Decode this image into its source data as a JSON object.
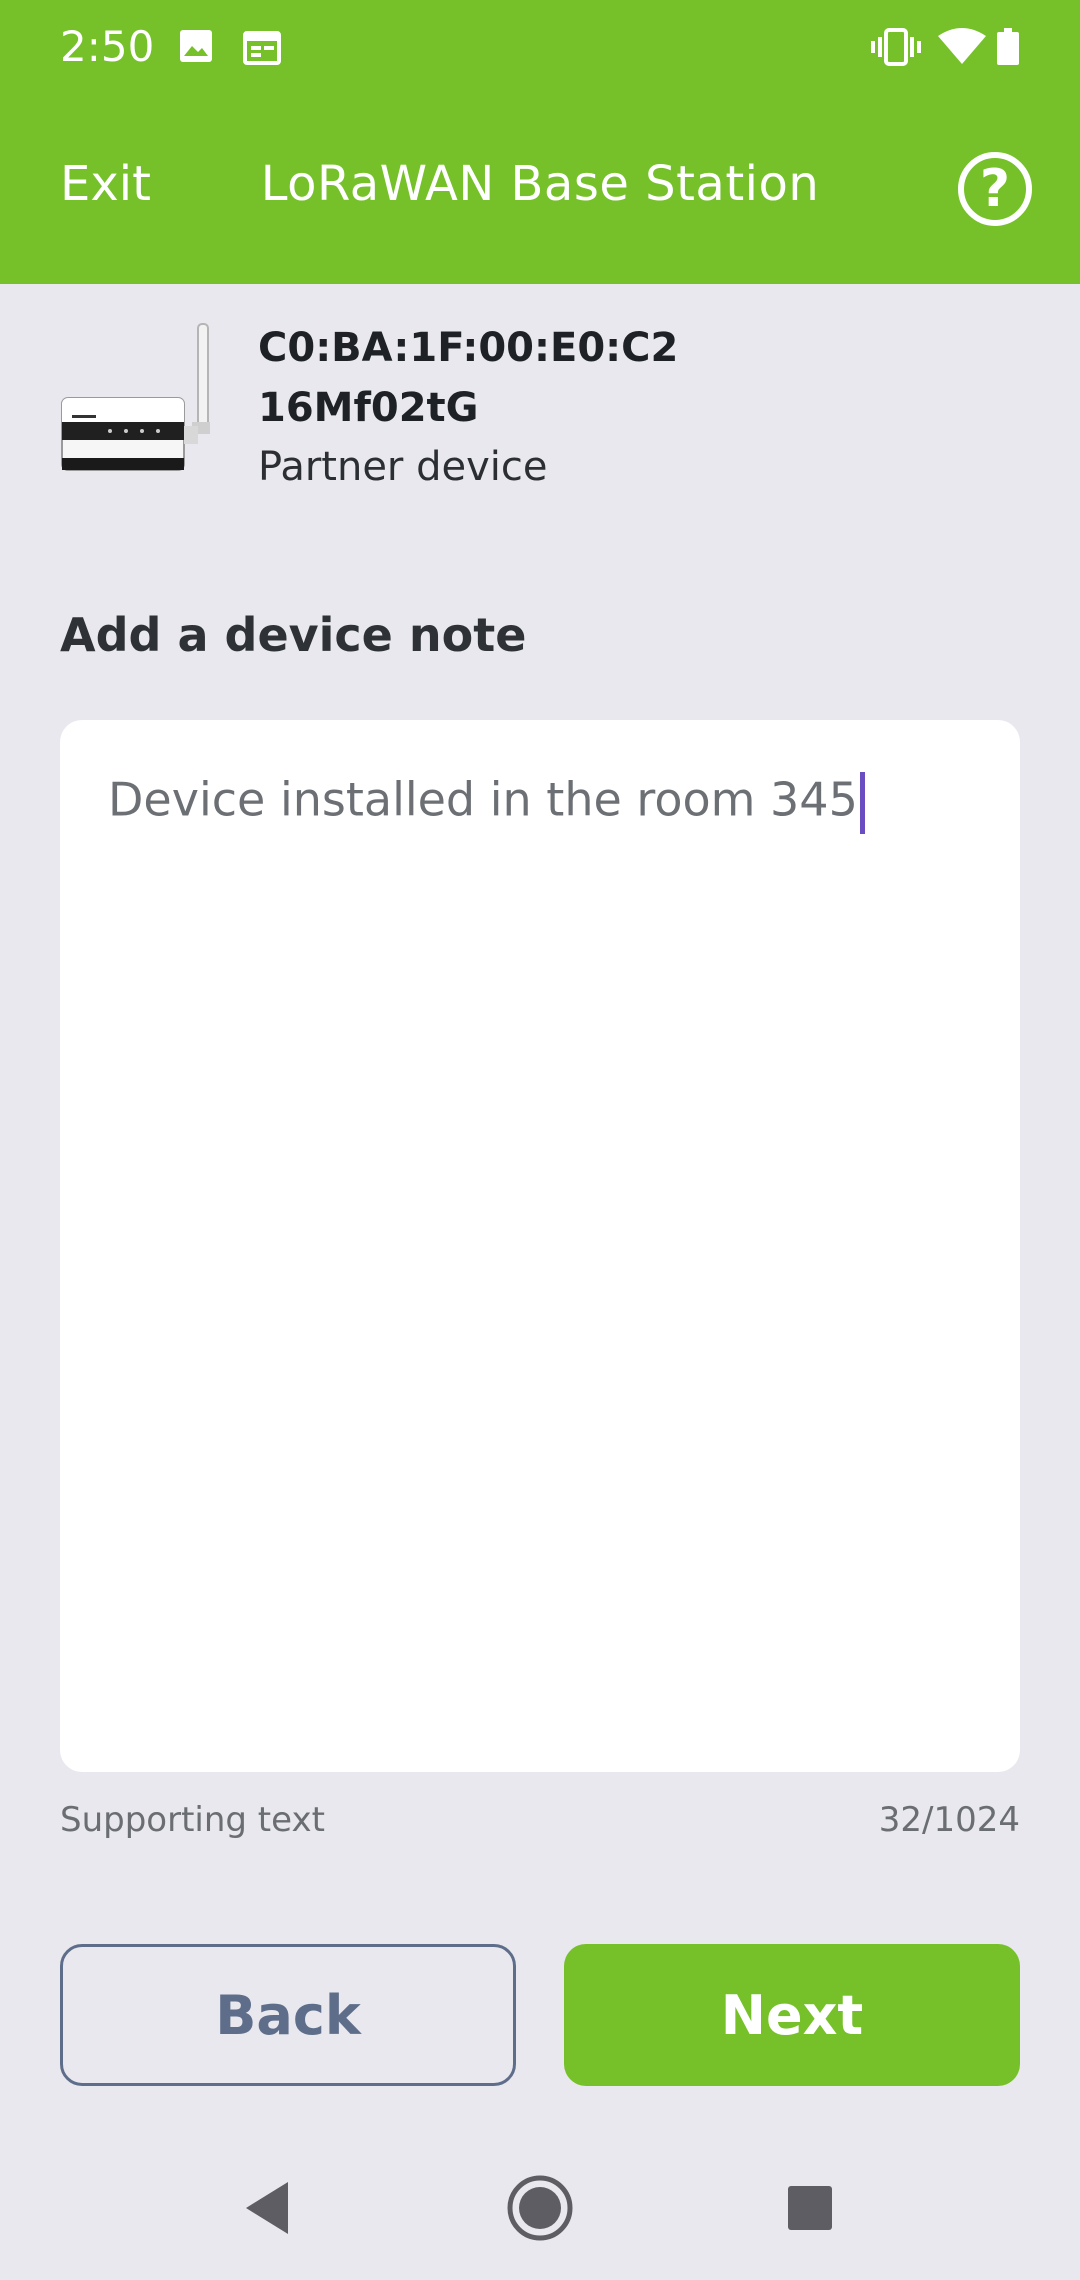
{
  "status_bar": {
    "time": "2:50",
    "left_icons": [
      "image-icon",
      "calendar-icon"
    ],
    "right_icons": [
      "vibrate-icon",
      "wifi-icon",
      "battery-icon"
    ]
  },
  "app_bar": {
    "exit_label": "Exit",
    "title": "LoRaWAN Base Station",
    "help_glyph": "?"
  },
  "device": {
    "mac": "C0:BA:1F:00:E0:C2",
    "code": "16Mf02tG",
    "type": "Partner device",
    "image_icon": "base-station-device-image"
  },
  "note": {
    "section_title": "Add a device note",
    "value": "Device installed in the room 345",
    "supporting_text": "Supporting text",
    "counter": "32/1024"
  },
  "buttons": {
    "back_label": "Back",
    "next_label": "Next"
  },
  "nav_bar": {
    "icons": [
      "back-triangle-icon",
      "home-circle-icon",
      "recents-square-icon"
    ]
  },
  "colors": {
    "brand_green": "#76c12a",
    "background": "#e8e8ee",
    "back_button_outline": "#5e6e8a",
    "caret": "#6a4dc0"
  }
}
